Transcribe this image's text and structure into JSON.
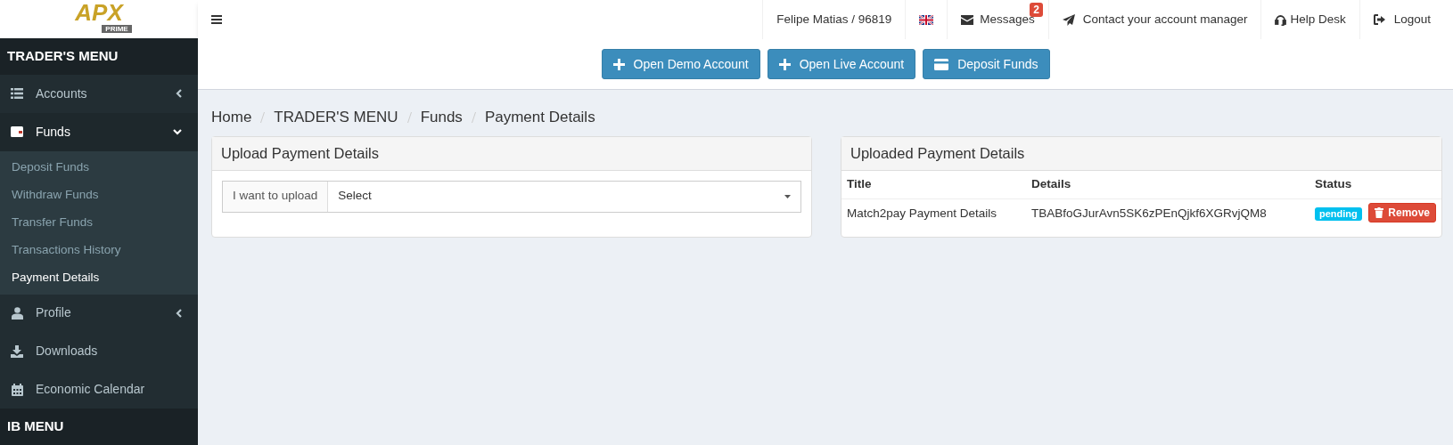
{
  "logo": {
    "name": "APX",
    "tagline": "PRIME"
  },
  "topbar": {
    "user": "Felipe Matias / 96819",
    "messages": {
      "label": "Messages",
      "badge": "2"
    },
    "contact": "Contact your account manager",
    "help": "Help Desk",
    "logout": "Logout"
  },
  "sidebar": {
    "sections": [
      {
        "title": "TRADER'S MENU",
        "items": [
          {
            "label": "Accounts",
            "expanded": false
          },
          {
            "label": "Funds",
            "expanded": true,
            "children": [
              {
                "label": "Deposit Funds",
                "selected": false
              },
              {
                "label": "Withdraw Funds",
                "selected": false
              },
              {
                "label": "Transfer Funds",
                "selected": false
              },
              {
                "label": "Transactions History",
                "selected": false
              },
              {
                "label": "Payment Details",
                "selected": true
              }
            ]
          },
          {
            "label": "Profile",
            "expanded": false
          },
          {
            "label": "Downloads"
          },
          {
            "label": "Economic Calendar"
          }
        ]
      },
      {
        "title": "IB MENU"
      }
    ]
  },
  "actions": [
    {
      "label": "Open Demo Account"
    },
    {
      "label": "Open Live Account"
    },
    {
      "label": "Deposit Funds"
    }
  ],
  "breadcrumb": [
    "Home",
    "TRADER'S MENU",
    "Funds",
    "Payment Details"
  ],
  "upload_panel": {
    "title": "Upload Payment Details",
    "field_label": "I want to upload",
    "select_value": "Select"
  },
  "uploaded_panel": {
    "title": "Uploaded Payment Details",
    "columns": [
      "Title",
      "Details",
      "Status"
    ],
    "rows": [
      {
        "title": "Match2pay Payment Details",
        "details": "TBABfoGJurAvn5SK6zPEnQjkf6XGRvjQM8",
        "status": "pending",
        "action": "Remove"
      }
    ]
  }
}
